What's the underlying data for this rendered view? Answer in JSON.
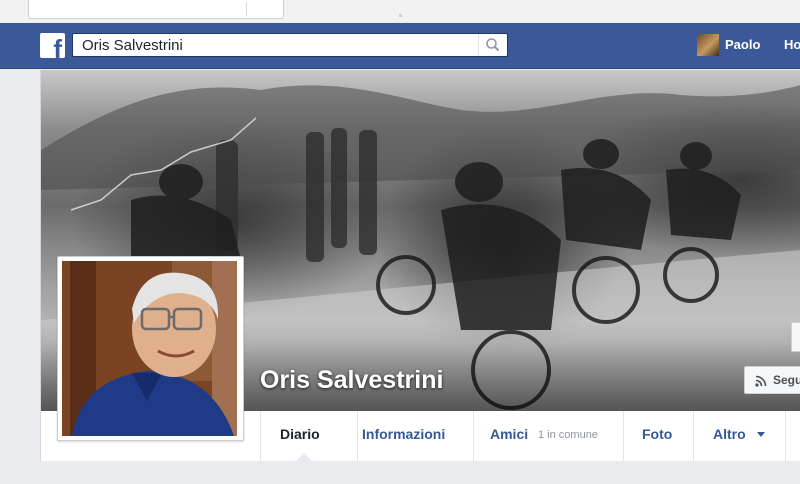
{
  "header": {
    "logo": "f",
    "search_value": "Oris Salvestrini",
    "search_icon": "search-icon",
    "user_name": "Paolo",
    "home_label": "Ho"
  },
  "profile": {
    "name": "Oris Salvestrini",
    "follow_label": "Segu",
    "follow_icon": "rss-icon"
  },
  "tabs": {
    "diario": "Diario",
    "informazioni": "Informazioni",
    "amici": "Amici",
    "amici_sub": "1 in comune",
    "foto": "Foto",
    "altro": "Altro"
  },
  "colors": {
    "brand_blue": "#3b5998",
    "link_blue": "#365899",
    "page_bg": "#e9ebee"
  }
}
